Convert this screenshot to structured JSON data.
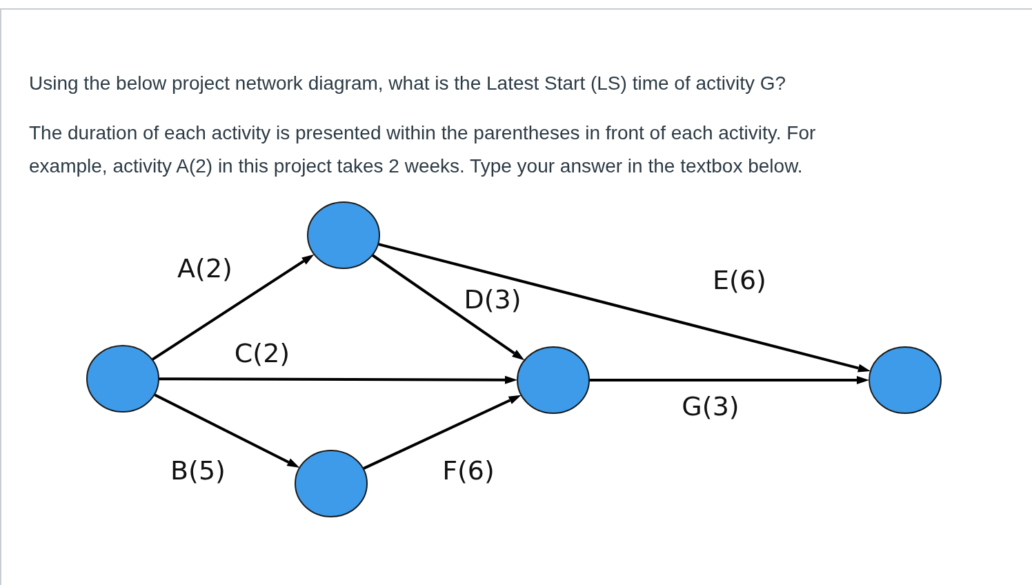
{
  "question": {
    "paragraphs": [
      "Using the below project network diagram, what is the Latest Start (LS) time of activity G?",
      "The duration of each activity is presented within the parentheses in front of each activity. For example, activity A(2) in this project takes 2 weeks. Type your answer in the textbox below."
    ]
  },
  "diagram": {
    "activities": [
      {
        "label": "A(2)"
      },
      {
        "label": "C(2)"
      },
      {
        "label": "B(5)"
      },
      {
        "label": "D(3)"
      },
      {
        "label": "E(6)"
      },
      {
        "label": "F(6)"
      },
      {
        "label": "G(3)"
      }
    ]
  }
}
